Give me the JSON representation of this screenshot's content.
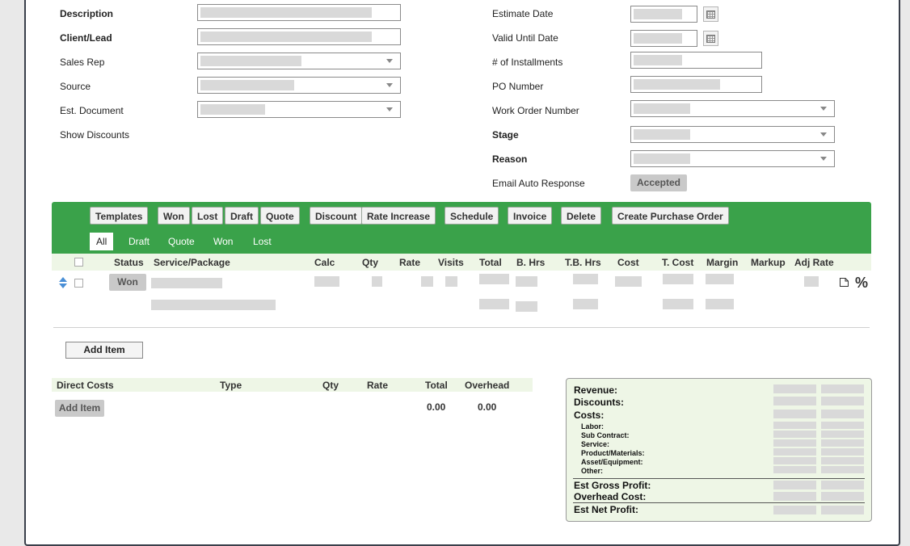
{
  "form": {
    "left": {
      "description_label": "Description",
      "client_label": "Client/Lead",
      "sales_rep_label": "Sales Rep",
      "source_label": "Source",
      "est_document_label": "Est. Document",
      "show_discounts_label": "Show Discounts"
    },
    "right": {
      "estimate_date_label": "Estimate Date",
      "valid_until_label": "Valid Until Date",
      "installments_label": "# of Installments",
      "po_number_label": "PO Number",
      "work_order_label": "Work Order Number",
      "stage_label": "Stage",
      "reason_label": "Reason",
      "email_auto_label": "Email Auto Response",
      "email_auto_value": "Accepted"
    }
  },
  "toolbar": {
    "buttons": [
      "Templates",
      "Won",
      "Lost",
      "Draft",
      "Quote",
      "Discount",
      "Rate Increase",
      "Schedule",
      "Invoice",
      "Delete",
      "Create Purchase Order"
    ]
  },
  "filters": {
    "tabs": [
      "All",
      "Draft",
      "Quote",
      "Won",
      "Lost"
    ],
    "active": "All"
  },
  "items_table": {
    "headers": [
      "Status",
      "Service/Package",
      "Calc",
      "Qty",
      "Rate",
      "Visits",
      "Total",
      "B. Hrs",
      "T.B. Hrs",
      "Cost",
      "T. Cost",
      "Margin",
      "Markup",
      "Adj Rate"
    ],
    "row1_status": "Won",
    "percent_symbol": "%"
  },
  "add_item_label": "Add Item",
  "direct_costs": {
    "headers": [
      "Direct Costs",
      "Type",
      "Qty",
      "Rate",
      "Total",
      "Overhead"
    ],
    "add_item_label": "Add Item",
    "total_value": "0.00",
    "overhead_value": "0.00"
  },
  "summary": {
    "revenue": "Revenue:",
    "discounts": "Discounts:",
    "costs": "Costs:",
    "labor": "Labor:",
    "sub_contract": "Sub Contract:",
    "service": "Service:",
    "product_materials": "Product/Materials:",
    "asset_equipment": "Asset/Equipment:",
    "other": "Other:",
    "gross_profit": "Est Gross Profit:",
    "overhead_cost": "Overhead Cost:",
    "net_profit": "Est Net Profit:"
  },
  "colors": {
    "accent_green": "#3aa24a",
    "light_green": "#eef6e6"
  }
}
